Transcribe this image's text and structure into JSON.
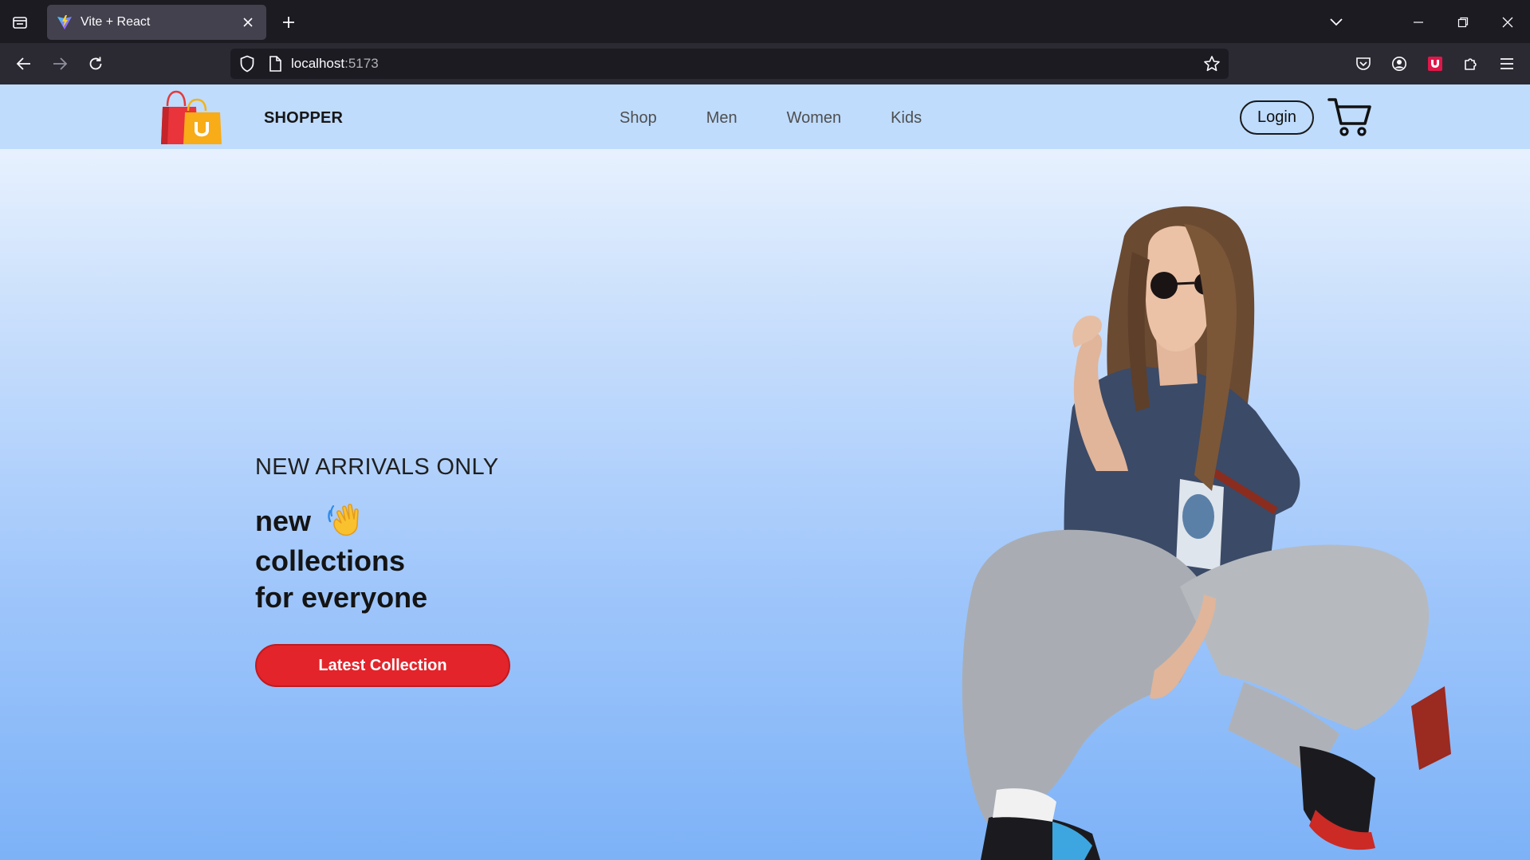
{
  "browser": {
    "tab": {
      "title": "Vite + React",
      "favicon": "vite-logo-icon"
    },
    "url": {
      "host": "localhost",
      "port": ":5173"
    },
    "icons": [
      "tab-list-icon",
      "close-icon",
      "plus-icon",
      "chevron-down-icon",
      "minimize-icon",
      "restore-icon",
      "close-window-icon",
      "back-arrow-icon",
      "forward-arrow-icon",
      "reload-icon",
      "shield-icon",
      "page-icon",
      "star-icon",
      "pocket-icon",
      "account-icon",
      "extension-badge-icon",
      "puzzle-icon",
      "hamburger-menu-icon"
    ]
  },
  "site": {
    "brand": "SHOPPER",
    "logo": "shopping-bag-logo-icon",
    "nav": [
      {
        "label": "Shop"
      },
      {
        "label": "Men"
      },
      {
        "label": "Women"
      },
      {
        "label": "Kids"
      }
    ],
    "login_label": "Login",
    "cart_icon": "cart-icon"
  },
  "hero": {
    "eyebrow": "NEW ARRIVALS ONLY",
    "lines": [
      "new",
      "collections",
      "for everyone"
    ],
    "wave_icon": "waving-hand-icon",
    "cta_label": "Latest Collection",
    "image": "model-photo"
  },
  "colors": {
    "chrome_dark": "#1c1b22",
    "chrome_toolbar": "#2b2a33",
    "header_bg": "#bfdcfd",
    "accent_red": "#e3242b",
    "text_dark": "#141414"
  }
}
